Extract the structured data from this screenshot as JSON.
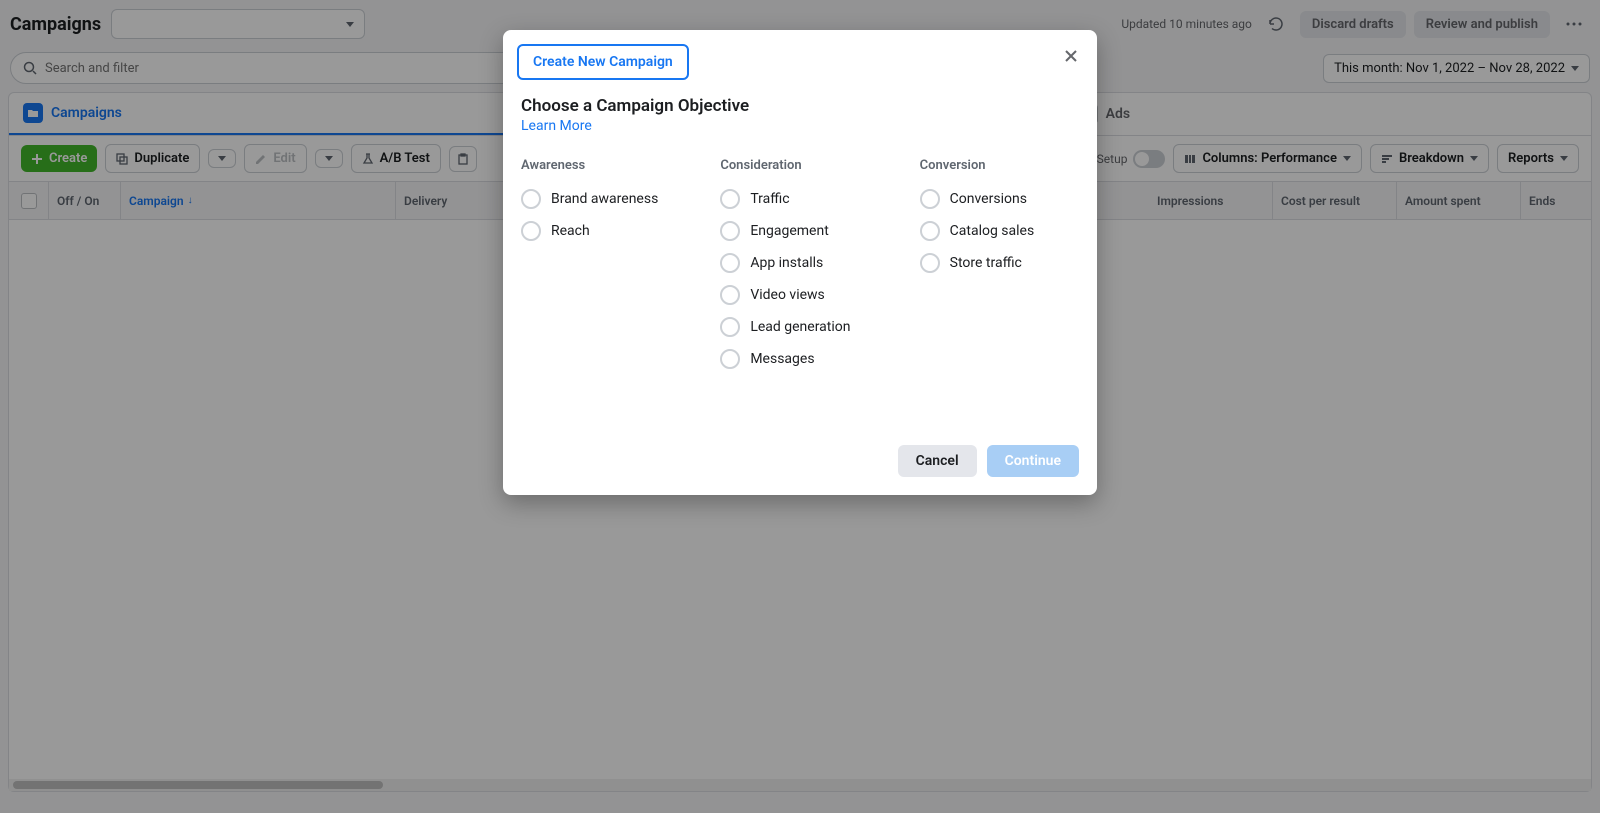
{
  "header": {
    "title": "Campaigns",
    "updated": "Updated 10 minutes ago",
    "discard": "Discard drafts",
    "review": "Review and publish"
  },
  "search": {
    "placeholder": "Search and filter",
    "date_range": "This month: Nov 1, 2022 – Nov 28, 2022"
  },
  "tabs": {
    "campaigns": "Campaigns",
    "ads": "Ads"
  },
  "toolbar": {
    "create": "Create",
    "duplicate": "Duplicate",
    "edit": "Edit",
    "ab_test": "A/B Test",
    "view_setup": "View Setup",
    "columns": "Columns: Performance",
    "breakdown": "Breakdown",
    "reports": "Reports"
  },
  "table": {
    "off_on": "Off / On",
    "campaign": "Campaign",
    "delivery": "Delivery",
    "impressions": "Impressions",
    "cost": "Cost per result",
    "amount": "Amount spent",
    "ends": "Ends"
  },
  "modal": {
    "tab_label": "Create New Campaign",
    "title": "Choose a Campaign Objective",
    "learn_more": "Learn More",
    "col_awareness": "Awareness",
    "col_consideration": "Consideration",
    "col_conversion": "Conversion",
    "awareness": [
      "Brand awareness",
      "Reach"
    ],
    "consideration": [
      "Traffic",
      "Engagement",
      "App installs",
      "Video views",
      "Lead generation",
      "Messages"
    ],
    "conversion": [
      "Conversions",
      "Catalog sales",
      "Store traffic"
    ],
    "cancel": "Cancel",
    "continue": "Continue"
  }
}
